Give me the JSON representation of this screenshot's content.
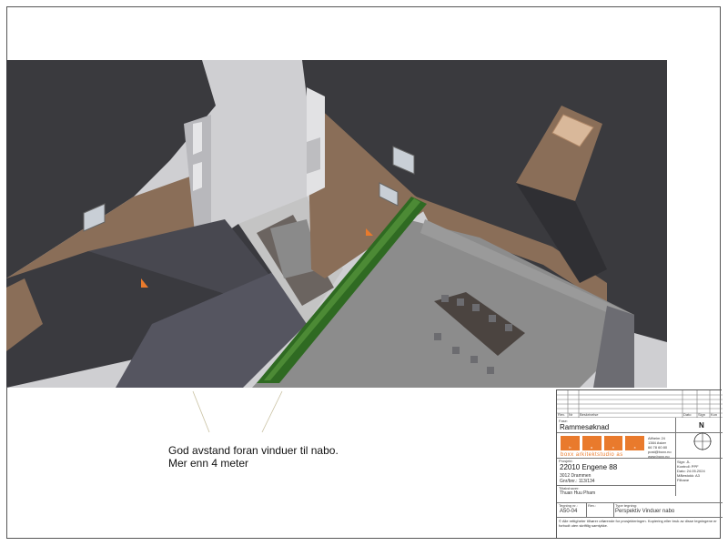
{
  "note": {
    "line1": "God avstand foran vinduer til nabo.",
    "line2": "Mer enn 4 meter"
  },
  "titleblock": {
    "rev_headers": [
      "Rev.",
      "Nr",
      "Beskrivelse",
      "Dato",
      "Sign",
      "Kon"
    ],
    "fase_label": "Fase:",
    "fase": "Rammesøknad",
    "company_address": [
      "Aifheim 24",
      "1384 Asker",
      "66 78 60 80",
      "post@boxx.no",
      "www.boxx.no"
    ],
    "logo_letters": [
      "b",
      "o",
      "x",
      "x"
    ],
    "studio": "boxx arkitektstudio as",
    "north": "N",
    "sign": "Sign: JL",
    "kontroll": "Kontroll: PPF",
    "dato": "Dato: 24.05.2024",
    "malestokk": "Målestokk: A3",
    "filbane": "Filbane",
    "prosjekt_label": "Prosjekt:",
    "prosjekt": "22010 Engene 88",
    "adresse": "3012 Drammen",
    "gnr": "Gnr/bnr.: 113/134",
    "tiltakshaver_label": "Tiltakshaver:",
    "tiltakshaver": "Thuan Huu Pham",
    "tegning_label": "Tegning nr.:",
    "tegning": "A50-04",
    "rev_label": "Rev.:",
    "type_label": "Type tegning:",
    "type": "Perspektiv Vinduer nabo",
    "copyright": "© Alle rettigheter tilhører utførende for prosjekteringen. Kopiering eller bruk av disse tegningene er forbudt uten skriftlig samtykke."
  },
  "colors": {
    "roof_dark": "#3a3a3e",
    "brick": "#8a6e58",
    "terrace": "#8c8c8c",
    "hedge": "#2f6a22",
    "accent": "#e97a2c"
  }
}
